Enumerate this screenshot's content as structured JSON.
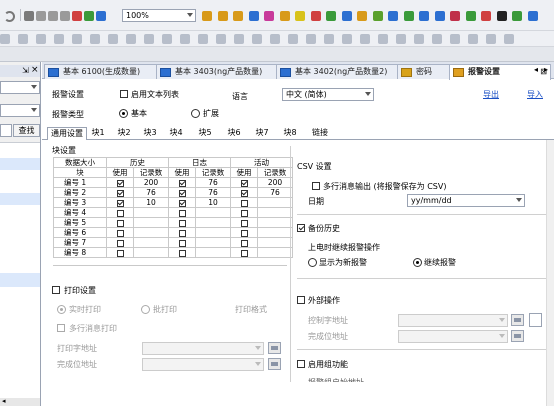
{
  "toolbar1": {
    "zoom": "100%",
    "colors": [
      "#7a7a7a",
      "#9a9a9a",
      "#9a9a9a",
      "#9a9a9a",
      "#d04040",
      "#3a9a3a",
      "#2c6fd1",
      "#d89a1a",
      "#d89a1a",
      "#d89a1a",
      "#2c6fd1",
      "#c83a9a",
      "#d89a1a",
      "#d8c21a",
      "#d04040",
      "#3a9a3a",
      "#2c6fd1",
      "#d89a1a",
      "#5aa02c",
      "#2c6fd1",
      "#3a9a3a",
      "#2c6fd1",
      "#2c6fd1",
      "#c0304a",
      "#3a9a3a",
      "#d04040",
      "#222222",
      "#3a9a3a",
      "#2c6fd1"
    ]
  },
  "left_pane": {
    "find_button": "查找"
  },
  "tabs": [
    {
      "label": "基本 6100(生成数量)",
      "close": "⊠"
    },
    {
      "label": "基本 3403(ng产品数量)",
      "close": "⊠"
    },
    {
      "label": "基本 3402(ng产品数量2)",
      "close": "⊠"
    },
    {
      "label": "密码",
      "close": "⊠"
    },
    {
      "label": "报警设置",
      "close": "⊠"
    }
  ],
  "alarm": {
    "settings_label": "报警设置",
    "enable_text_list": "启用文本列表",
    "language_label": "语言",
    "language_value": "中文 (简体)",
    "export": "导出",
    "import": "导入",
    "type_label": "报警类型",
    "type_basic": "基本",
    "type_extended": "扩展"
  },
  "subtabs": [
    "通用设置",
    "块1",
    "块2",
    "块3",
    "块4",
    "块5",
    "块6",
    "块7",
    "块8",
    "链接"
  ],
  "block": {
    "title": "块设置",
    "hdr_data_size": "数据大小",
    "hdr_history": "历史",
    "hdr_log": "日志",
    "hdr_active": "活动",
    "hdr_block": "块",
    "hdr_use": "使用",
    "hdr_records": "记录数",
    "rows": [
      {
        "name": "编号 1",
        "h_use": true,
        "h_rec": "200",
        "l_use": true,
        "l_rec": "76",
        "a_use": true,
        "a_rec": "200"
      },
      {
        "name": "编号 2",
        "h_use": true,
        "h_rec": "76",
        "l_use": true,
        "l_rec": "76",
        "a_use": true,
        "a_rec": "76"
      },
      {
        "name": "编号 3",
        "h_use": true,
        "h_rec": "10",
        "l_use": true,
        "l_rec": "10",
        "a_use": false,
        "a_rec": ""
      },
      {
        "name": "编号 4",
        "h_use": false,
        "h_rec": "",
        "l_use": false,
        "l_rec": "",
        "a_use": false,
        "a_rec": ""
      },
      {
        "name": "编号 5",
        "h_use": false,
        "h_rec": "",
        "l_use": false,
        "l_rec": "",
        "a_use": false,
        "a_rec": ""
      },
      {
        "name": "编号 6",
        "h_use": false,
        "h_rec": "",
        "l_use": false,
        "l_rec": "",
        "a_use": false,
        "a_rec": ""
      },
      {
        "name": "编号 7",
        "h_use": false,
        "h_rec": "",
        "l_use": false,
        "l_rec": "",
        "a_use": false,
        "a_rec": ""
      },
      {
        "name": "编号 8",
        "h_use": false,
        "h_rec": "",
        "l_use": false,
        "l_rec": "",
        "a_use": false,
        "a_rec": ""
      }
    ]
  },
  "print": {
    "title": "打印设置",
    "realtime": "实时打印",
    "batch": "批打印",
    "format": "打印格式",
    "multiline": "多行消息打印",
    "print_addr": "打印字地址",
    "done_addr": "完成位地址"
  },
  "csv": {
    "title": "CSV 设置",
    "multiline": "多行消息输出 (将报警保存为 CSV)",
    "date_label": "日期",
    "date_value": "yy/mm/dd"
  },
  "backup": {
    "title": "备份历史",
    "power_on": "上电时继续报警操作",
    "show_new": "显示为新报警",
    "continue": "继续报警"
  },
  "external": {
    "title": "外部操作",
    "control_addr": "控制字地址",
    "done_addr": "完成位地址"
  },
  "group": {
    "title": "启用组功能",
    "partial": "报警组启始地址"
  }
}
